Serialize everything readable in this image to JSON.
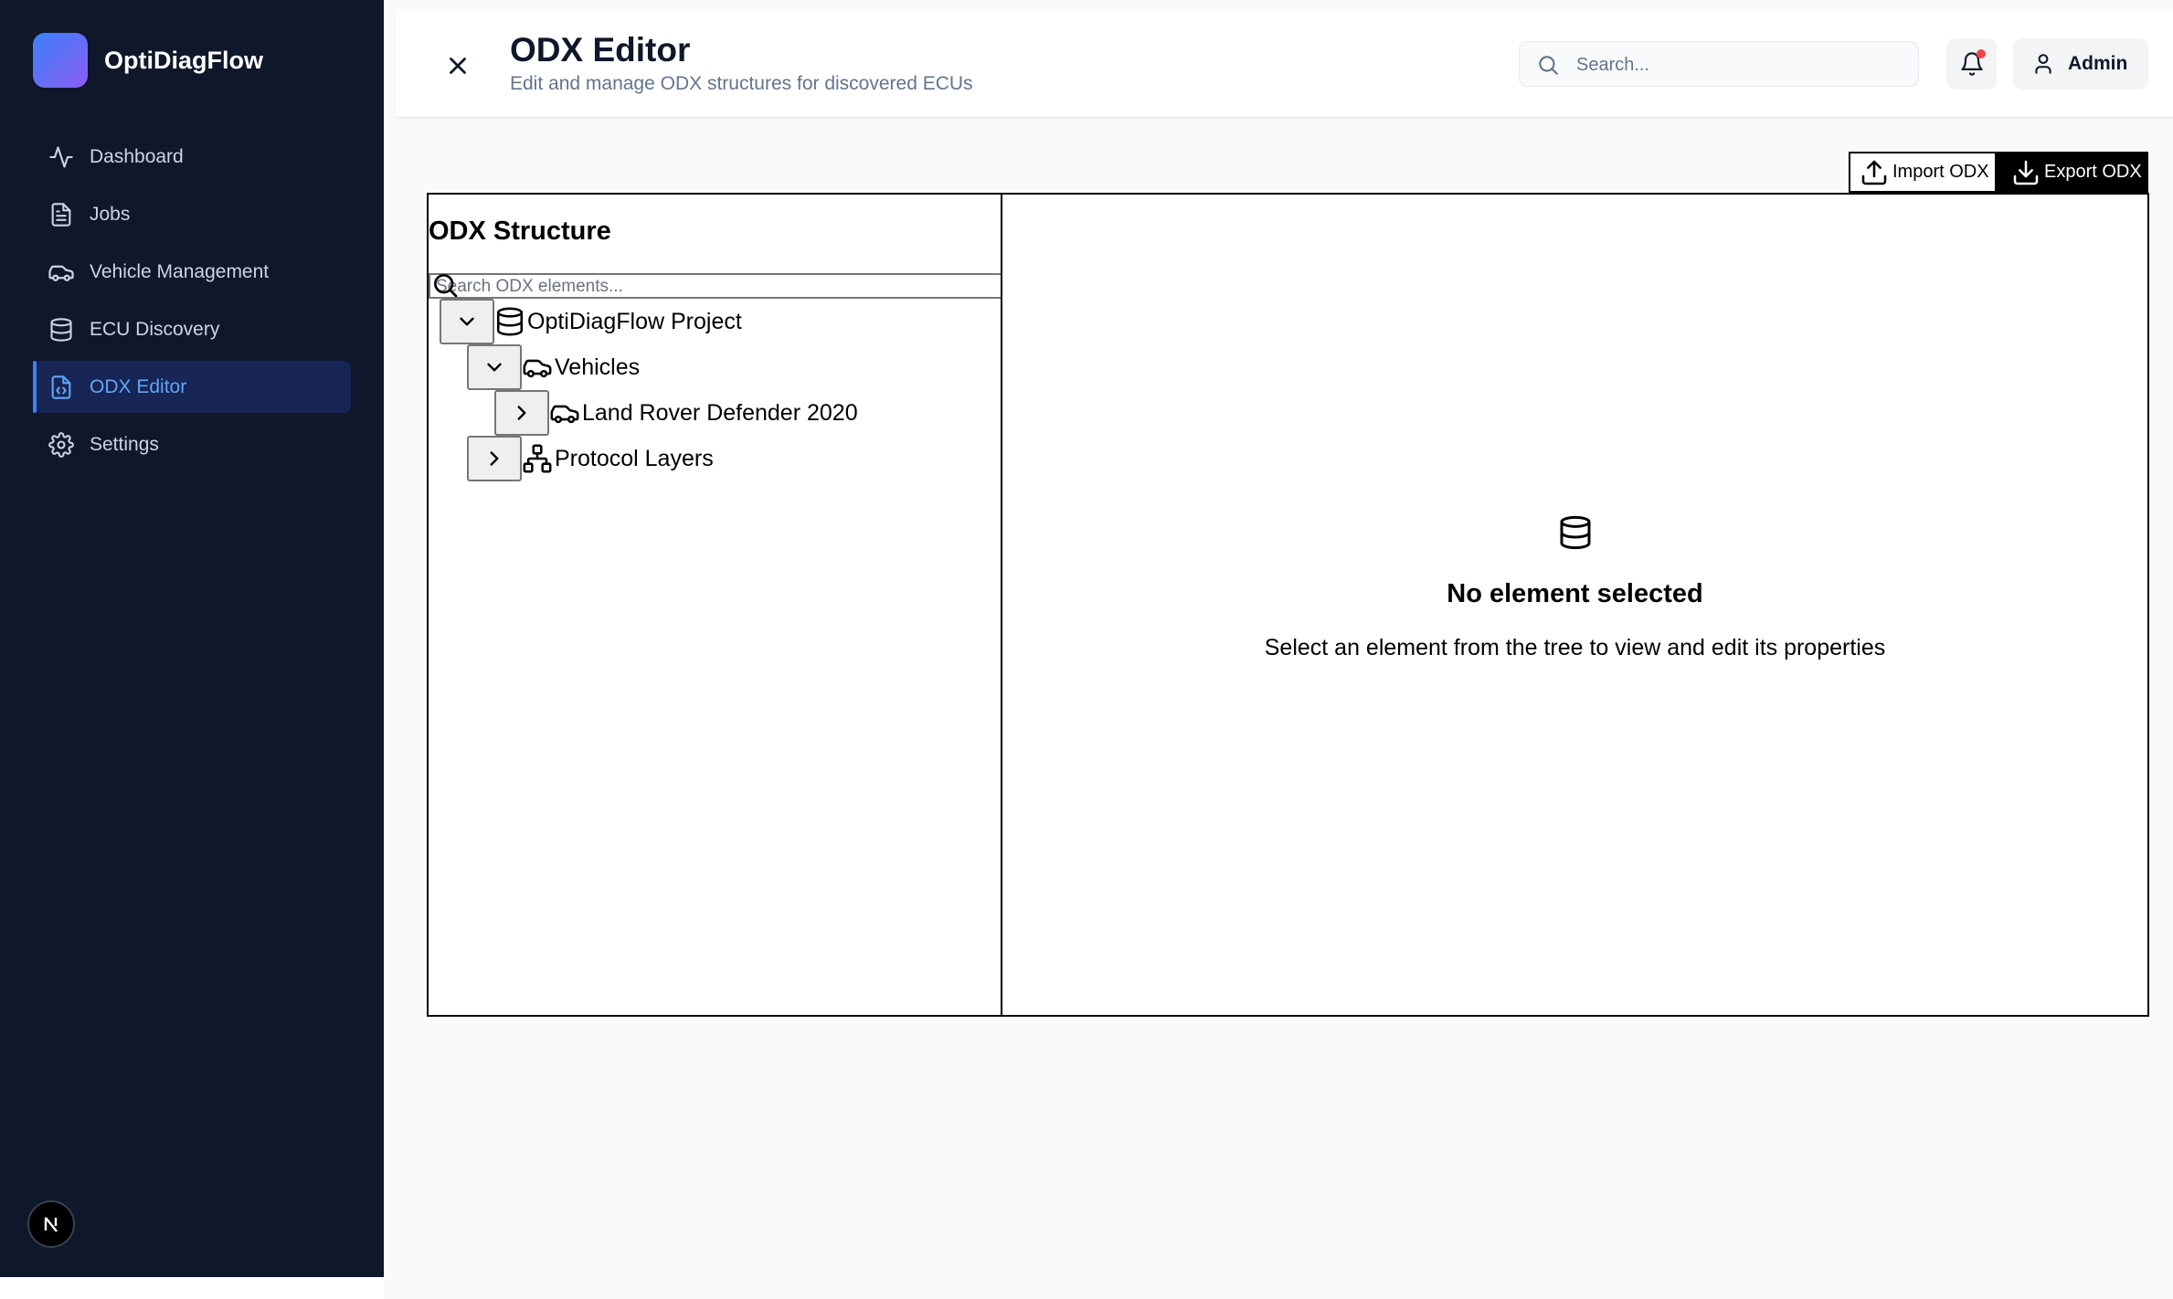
{
  "sidebar": {
    "app_name": "OptiDiagFlow",
    "items": [
      {
        "label": "Dashboard",
        "icon": "activity-icon"
      },
      {
        "label": "Jobs",
        "icon": "file-text-icon"
      },
      {
        "label": "Vehicle Management",
        "icon": "car-icon"
      },
      {
        "label": "ECU Discovery",
        "icon": "database-icon"
      },
      {
        "label": "ODX Editor",
        "icon": "file-code-icon",
        "active": true
      },
      {
        "label": "Settings",
        "icon": "gear-icon"
      }
    ],
    "badge_letter": "N"
  },
  "header": {
    "title": "ODX Editor",
    "subtitle": "Edit and manage ODX structures for discovered ECUs",
    "search_placeholder": "Search...",
    "user_label": "Admin"
  },
  "toolbar": {
    "import_label": "Import ODX",
    "export_label": "Export ODX"
  },
  "tree": {
    "title": "ODX Structure",
    "search_placeholder": "Search ODX elements...",
    "nodes": [
      {
        "label": "OptiDiagFlow Project",
        "icon": "database-icon",
        "expanded": true,
        "depth": 0
      },
      {
        "label": "Vehicles",
        "icon": "car-icon",
        "expanded": true,
        "depth": 1
      },
      {
        "label": "Land Rover Defender 2020",
        "icon": "car-icon",
        "expanded": false,
        "depth": 2
      },
      {
        "label": "Protocol Layers",
        "icon": "network-icon",
        "expanded": false,
        "depth": 1
      }
    ]
  },
  "detail": {
    "empty_title": "No element selected",
    "empty_desc": "Select an element from the tree to view and edit its properties"
  },
  "colors": {
    "sidebar_bg": "#0f172a",
    "accent": "#3b82f6",
    "active_text": "#60a5fa",
    "notification_dot": "#ef4444"
  }
}
